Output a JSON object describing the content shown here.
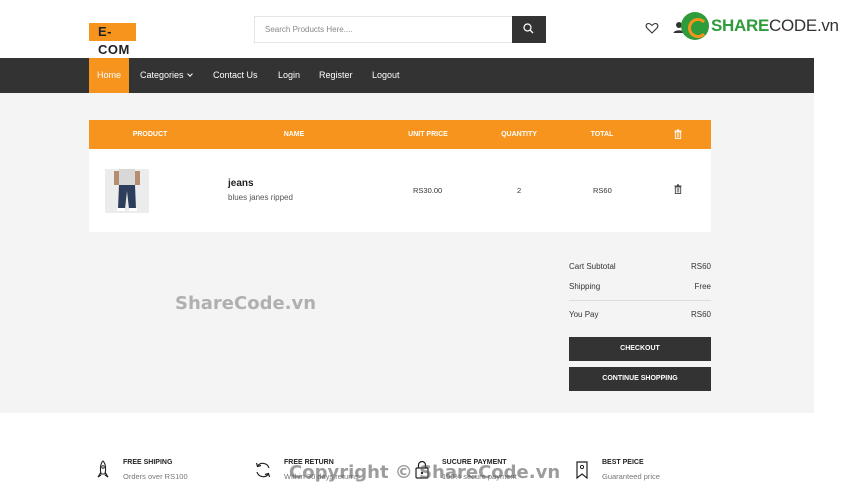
{
  "header": {
    "logo_text": "E-COM",
    "search_placeholder": "Search Products Here....",
    "brand_prefix": "SHARE",
    "brand_mid": "CODE",
    "brand_suffix": ".vn"
  },
  "nav": {
    "items": [
      {
        "label": "Home",
        "active": true
      },
      {
        "label": "Categories",
        "active": false
      },
      {
        "label": "Contact Us",
        "active": false
      },
      {
        "label": "Login",
        "active": false
      },
      {
        "label": "Register",
        "active": false
      },
      {
        "label": "Logout",
        "active": false
      }
    ]
  },
  "cart": {
    "headers": [
      "PRODUCT",
      "NAME",
      "UNIT PRICE",
      "QUANTITY",
      "TOTAL"
    ],
    "delete_header_icon": "trash-icon",
    "rows": [
      {
        "name": "jeans",
        "description": "blues janes ripped",
        "unit_price": "RS30.00",
        "quantity": "2",
        "total": "RS60",
        "image_icon": "jeans-product-image"
      }
    ]
  },
  "summary": {
    "subtotal_label": "Cart Subtotal",
    "subtotal_value": "RS60",
    "shipping_label": "Shipping",
    "shipping_value": "Free",
    "pay_label": "You Pay",
    "pay_value": "RS60",
    "checkout_label": "CHECKOUT",
    "continue_label": "CONTINUE SHOPPING"
  },
  "watermarks": {
    "center": "ShareCode.vn",
    "footer": "Copyright © ShareCode.vn"
  },
  "features": [
    {
      "title": "FREE SHIPING",
      "subtitle": "Orders over RS100",
      "icon": "rocket-icon"
    },
    {
      "title": "FREE RETURN",
      "subtitle": "Within 30 days returns",
      "icon": "refresh-icon"
    },
    {
      "title": "SUCURE PAYMENT",
      "subtitle": "100% secure payment",
      "icon": "lock-icon"
    },
    {
      "title": "BEST PEICE",
      "subtitle": "Guaranteed price",
      "icon": "tag-icon"
    }
  ],
  "colors": {
    "accent": "#f7941d",
    "dark": "#333333",
    "brand_green": "#2e9c3a"
  }
}
